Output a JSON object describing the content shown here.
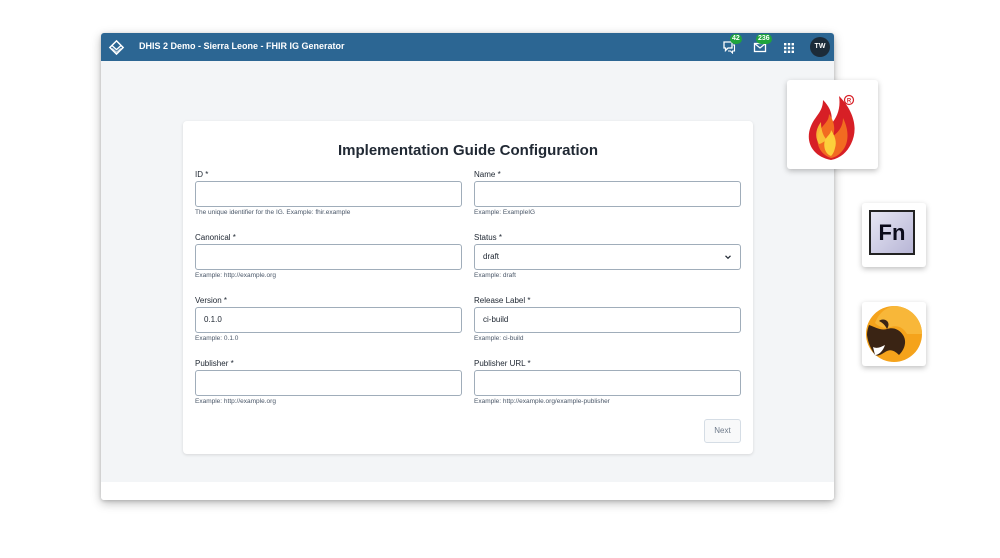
{
  "header": {
    "title": "DHIS 2 Demo - Sierra Leone - FHIR IG Generator",
    "messages_badge": "42",
    "email_badge": "236",
    "avatar_initials": "TW"
  },
  "form": {
    "title": "Implementation Guide Configuration",
    "fields": {
      "id": {
        "label": "ID *",
        "value": "",
        "help": "The unique identifier for the IG. Example: fhir.example"
      },
      "name": {
        "label": "Name *",
        "value": "",
        "help": "Example: ExampleIG"
      },
      "canonical": {
        "label": "Canonical *",
        "value": "",
        "help": "Example: http://example.org"
      },
      "status": {
        "label": "Status *",
        "value": "draft",
        "help": "Example: draft"
      },
      "version": {
        "label": "Version *",
        "value": "0.1.0",
        "help": "Example: 0.1.0"
      },
      "release_label": {
        "label": "Release Label *",
        "value": "ci-build",
        "help": "Example: ci-build"
      },
      "publisher": {
        "label": "Publisher *",
        "value": "",
        "help": "Example: http://example.org"
      },
      "publisher_url": {
        "label": "Publisher URL *",
        "value": "",
        "help": "Example: http://example.org/example-publisher"
      }
    },
    "next_label": "Next"
  },
  "side_logos": {
    "fhir": "fhir-flame-logo",
    "fn_label": "Fn",
    "camel": "camel-logo"
  },
  "colors": {
    "header": "#2c6693",
    "badge": "#20a43d",
    "avatar": "#1c2b39",
    "page_bg": "#f3f5f7"
  }
}
